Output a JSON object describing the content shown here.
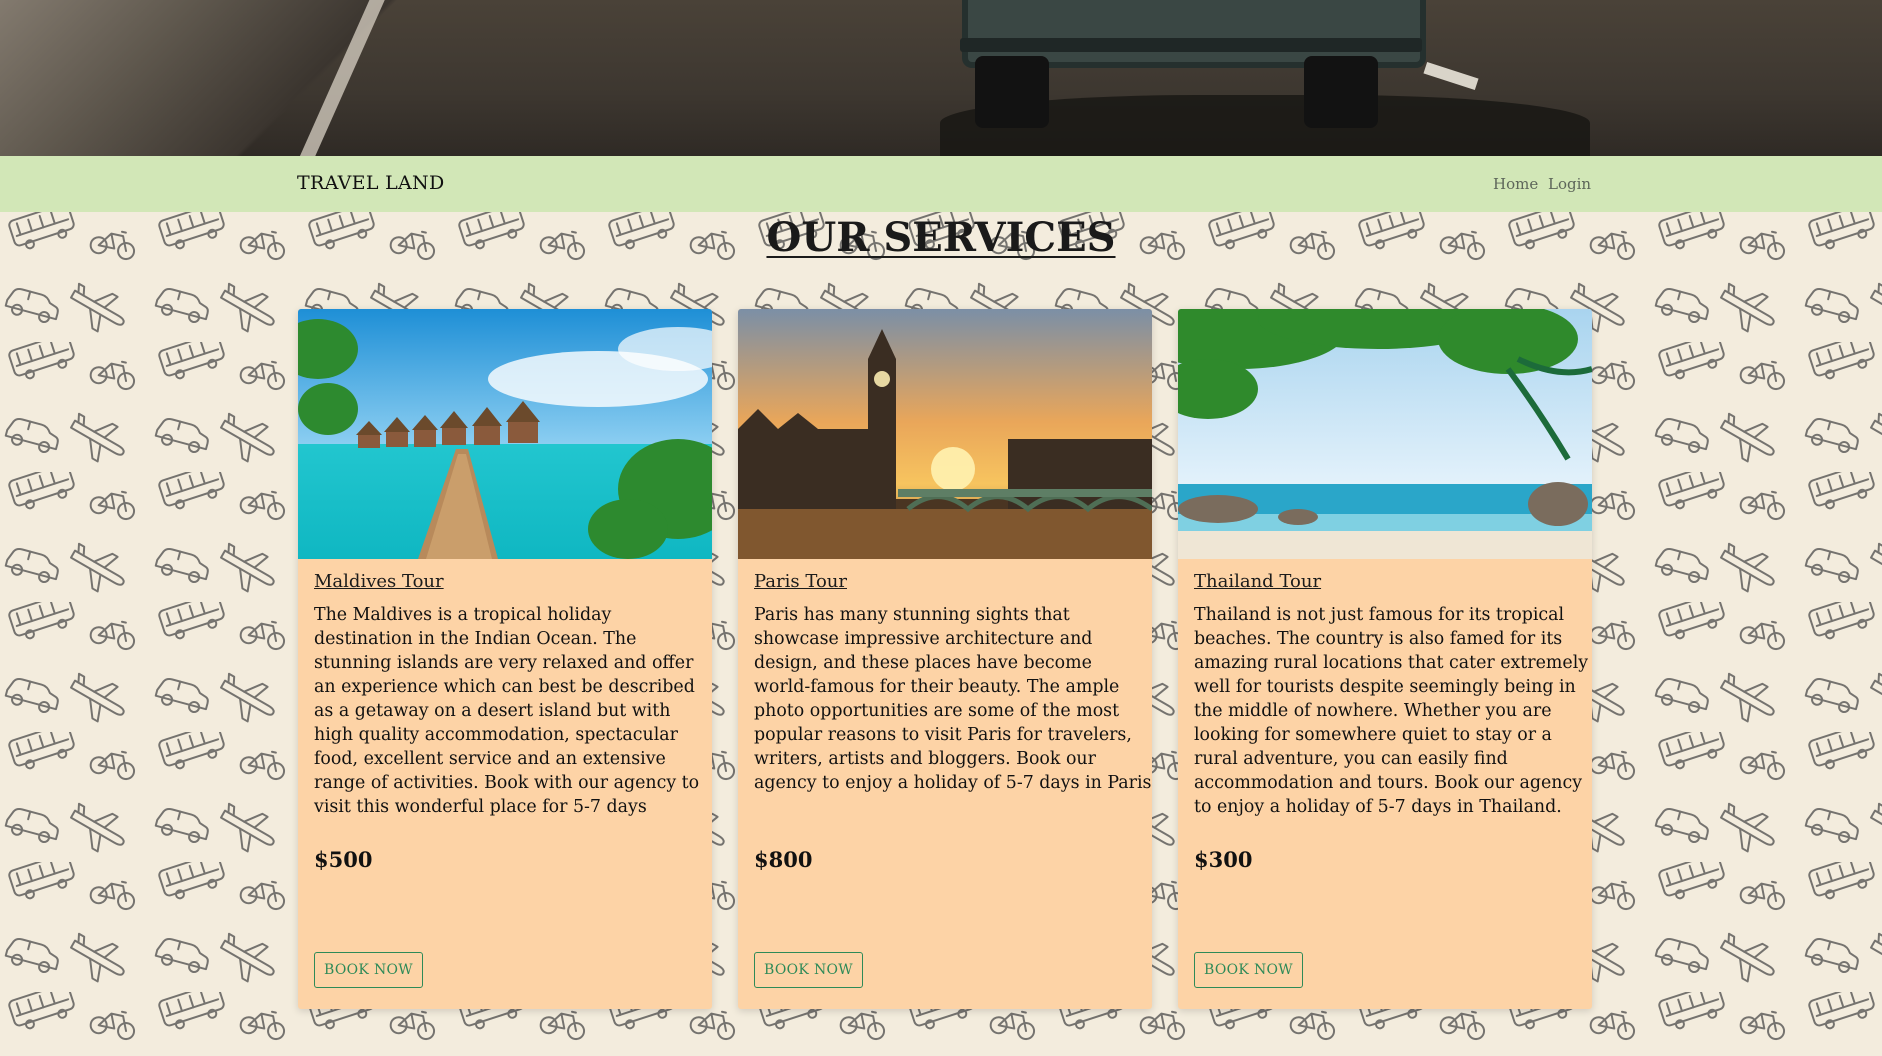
{
  "navbar": {
    "brand": "TRAVEL LAND",
    "links": [
      "Home",
      "Login"
    ]
  },
  "services": {
    "title": "OUR SERVICES",
    "cards": [
      {
        "title": "Maldives Tour",
        "description": "The Maldives is a tropical holiday destination in the Indian Ocean. The stunning islands are very relaxed and offer an experience which can best be described as a getaway on a desert island but with high quality accommodation, spectacular food, excellent service and an extensive range of activities. Book with our agency to visit this wonderful place for 5-7 days",
        "price": "$500",
        "button": "BOOK NOW"
      },
      {
        "title": "Paris Tour",
        "description": "Paris has many stunning sights that showcase impressive architecture and design, and these places have become world-famous for their beauty. The ample photo opportunities are some of the most popular reasons to visit Paris for travelers, writers, artists and bloggers. Book our agency to enjoy a holiday of 5-7 days in Paris",
        "price": "$800",
        "button": "BOOK NOW"
      },
      {
        "title": "Thailand Tour",
        "description": "Thailand is not just famous for its tropical beaches. The country is also famed for its amazing rural locations that cater extremely well for tourists despite seemingly being in the middle of nowhere. Whether you are looking for somewhere quiet to stay or a rural adventure, you can easily find accommodation and tours. Book our agency to enjoy a holiday of 5-7 days in Thailand.",
        "price": "$300",
        "button": "BOOK NOW"
      }
    ]
  },
  "colors": {
    "navbar_bg": "#d2e7b7",
    "card_bg": "#fdd3a6",
    "button_accent": "#2e8a58",
    "page_bg": "#f3ecdd"
  }
}
